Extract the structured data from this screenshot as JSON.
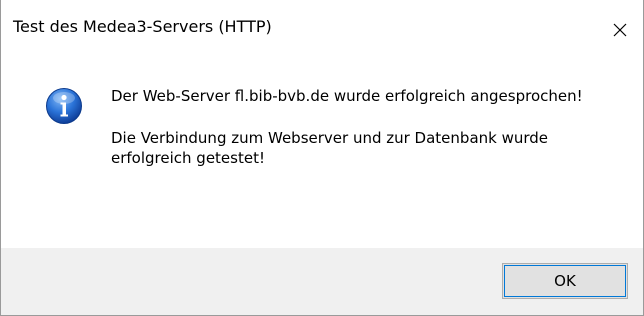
{
  "window": {
    "title": "Test des Medea3-Servers (HTTP)"
  },
  "icons": {
    "close": "close-icon",
    "message": "info-icon"
  },
  "message": {
    "line1": "Der Web-Server fl.bib-bvb.de wurde erfolgreich angesprochen!",
    "line2": "Die Verbindung zum Webserver und zur Datenbank wurde erfolgreich getestet!"
  },
  "buttons": {
    "ok_label": "OK"
  },
  "colors": {
    "info_icon": "#1e63c7",
    "button_focus": "#0078d7",
    "footer_bg": "#f0f0f0"
  }
}
